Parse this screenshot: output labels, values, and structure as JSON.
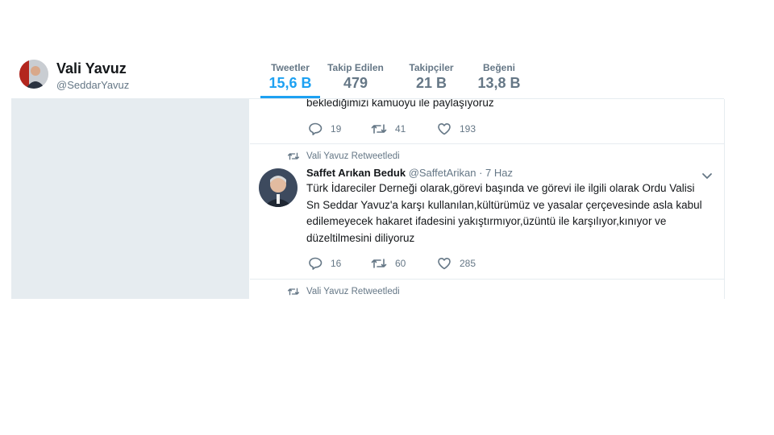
{
  "profile": {
    "name": "Vali Yavuz",
    "handle": "@SeddarYavuz",
    "avatar_icon": "profile-avatar-photo"
  },
  "stats": [
    {
      "label": "Tweetler",
      "value": "15,6 B",
      "active": true
    },
    {
      "label": "Takip Edilen",
      "value": "479"
    },
    {
      "label": "Takipçiler",
      "value": "21 B"
    },
    {
      "label": "Beğeni",
      "value": "13,8 B"
    }
  ],
  "feed": {
    "tweet1": {
      "text_tail": "beklediğimizi kamuoyu ile paylaşıyoruz",
      "replies": "19",
      "retweets": "41",
      "likes": "193"
    },
    "tweet2": {
      "context": "Vali Yavuz Retweetledi",
      "fullname": "Saffet Arıkan Beduk",
      "handle": "@SaffetArikan",
      "time": "· 7 Haz",
      "text": "Türk İdareciler Derneği olarak,görevi başında ve görevi ile ilgili olarak Ordu Valisi Sn Seddar Yavuz'a karşı kullanılan,kültürümüz ve yasalar çerçevesinde asla kabul edilemeyecek hakaret ifadesini yakıştırmıyor,üzüntü ile karşılıyor,kınıyor ve düzeltilmesini diliyoruz",
      "replies": "16",
      "retweets": "60",
      "likes": "285"
    },
    "tweet3": {
      "context": "Vali Yavuz Retweetledi"
    }
  },
  "colors": {
    "accent": "#1da1f2",
    "muted": "#657786",
    "panel": "#e6ecf0"
  }
}
